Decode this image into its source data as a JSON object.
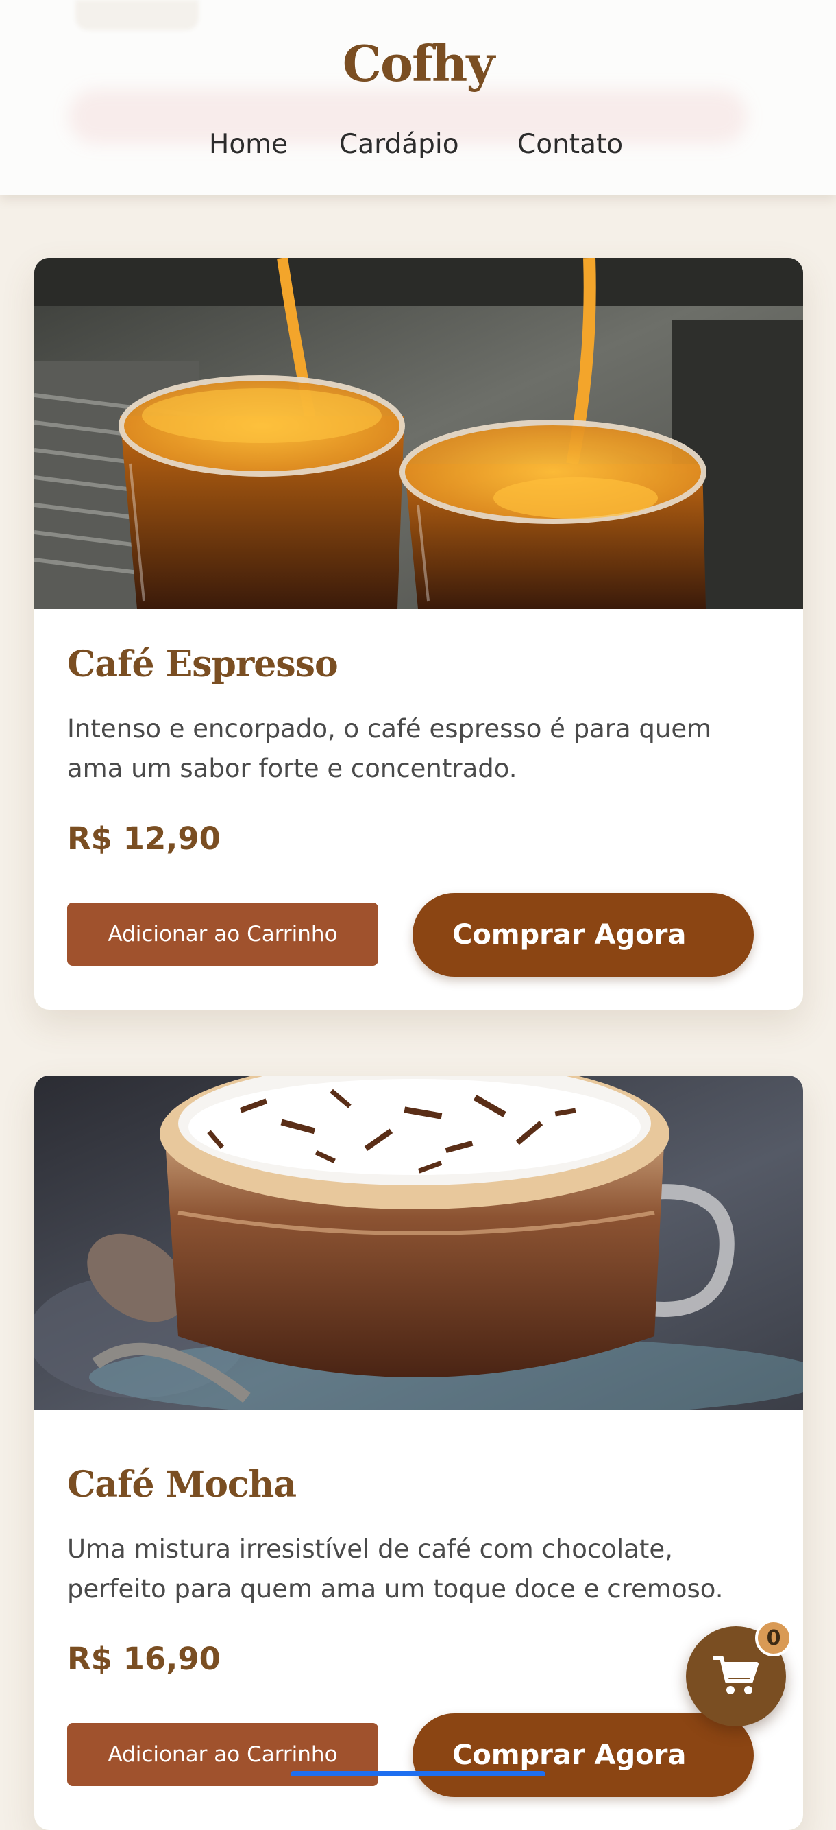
{
  "header": {
    "logo": "Cofhy",
    "nav": {
      "home": "Home",
      "menu": "Cardápio",
      "contact": "Contato"
    }
  },
  "products": [
    {
      "title": "Café Espresso",
      "description": "Intenso e encorpado, o café espresso é para quem ama um sabor forte e concentrado.",
      "price": "R$ 12,90",
      "add_label": "Adicionar ao Carrinho",
      "buy_label": "Comprar Agora"
    },
    {
      "title": "Café Mocha",
      "description": "Uma mistura irresistível de café com chocolate, perfeito para quem ama um toque doce e cremoso.",
      "price": "R$ 16,90",
      "add_label": "Adicionar ao Carrinho",
      "buy_label": "Comprar Agora"
    }
  ],
  "cart": {
    "count": "0",
    "icon": "shopping-cart-icon"
  },
  "colors": {
    "brand": "#7a4e22",
    "add_button": "#a0522d",
    "buy_button": "#8b4513",
    "background": "#f5f0e8",
    "badge": "#d99a55"
  }
}
